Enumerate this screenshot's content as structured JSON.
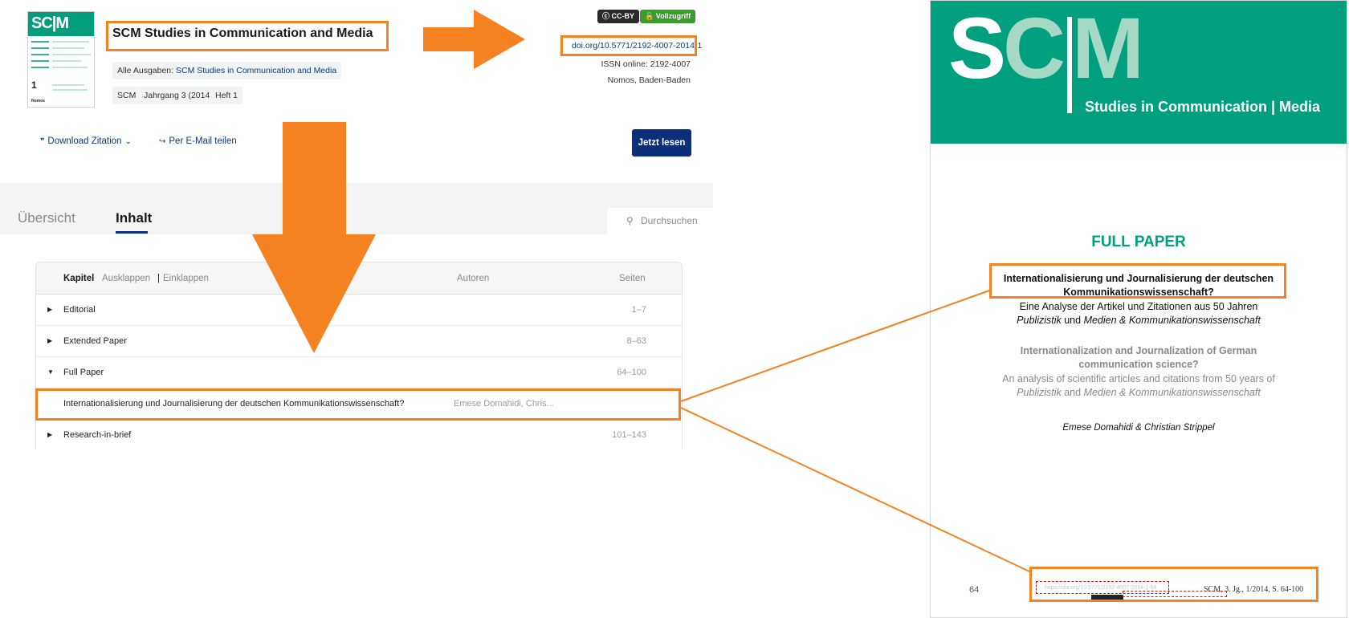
{
  "header": {
    "cover": {
      "logo_text": "SC|M",
      "subtitle": "Studies in Communication | Media",
      "issue_number": "1",
      "issue_year": "2014",
      "publisher": "Nomos"
    },
    "journal_title": "SCM Studies in Communication and Media",
    "all_issues_prefix": "Alle Ausgaben:",
    "all_issues_link": "SCM Studies in Communication and Media",
    "chips": [
      "SCM",
      "Jahrgang 3 (2014)",
      "Heft 1"
    ],
    "badges": {
      "license": "CC-BY",
      "access": "Vollzugriff"
    },
    "doi": "doi.org/10.5771/2192-4007-2014-1",
    "issn": "ISSN online: 2192-4007",
    "publisher_place": "Nomos, Baden-Baden"
  },
  "actions": {
    "download_citation": "Download Zitation",
    "share_email": "Per E-Mail teilen",
    "read_now": "Jetzt lesen"
  },
  "tabs": [
    {
      "label": "Übersicht",
      "active": false
    },
    {
      "label": "Inhalt",
      "active": true
    }
  ],
  "search": {
    "placeholder": "Durchsuchen"
  },
  "toc": {
    "headers": {
      "chapter": "Kapitel",
      "expand": "Ausklappen",
      "separator": "|",
      "collapse": "Einklappen",
      "authors": "Autoren",
      "pages": "Seiten"
    },
    "rows": [
      {
        "title": "Editorial",
        "authors": "",
        "pages": "1–7",
        "expanded": false,
        "child": false
      },
      {
        "title": "Extended Paper",
        "authors": "",
        "pages": "8–63",
        "expanded": false,
        "child": false
      },
      {
        "title": "Full Paper",
        "authors": "",
        "pages": "64–100",
        "expanded": true,
        "child": false
      },
      {
        "title": "Internationalisierung und Journalisierung der deutschen Kommunikationswissenschaft?",
        "authors": "Emese Domahidi, Chris...",
        "pages": "",
        "expanded": false,
        "child": true
      },
      {
        "title": "Research-in-brief",
        "authors": "",
        "pages": "101–143",
        "expanded": false,
        "child": false
      }
    ]
  },
  "pdf": {
    "logo": {
      "s": "S",
      "c": "C",
      "m": "M"
    },
    "journal_subtitle": "Studies in Communication | Media",
    "kicker": "FULL PAPER",
    "title_de_line1": "Internationalisierung und Journalisierung der deutschen",
    "title_de_line2": "Kommunikationswissenschaft?",
    "subtitle_de_line1": "Eine Analyse der Artikel und Zitationen aus 50 Jahren",
    "subtitle_de_line2_it1": "Publizistik",
    "subtitle_de_line2_mid": " und ",
    "subtitle_de_line2_it2": "Medien & Kommunikationswissenschaft",
    "title_en_line1": "Internationalization and Journalization of German",
    "title_en_line2": "communication science?",
    "subtitle_en_line1": "An analysis of scientific articles and citations from 50 years of",
    "subtitle_en_line2_it1": "Publizistik",
    "subtitle_en_line2_mid": " and ",
    "subtitle_en_line2_it2": "Medien & Kommunikationswissenschaft",
    "authors": "Emese Domahidi & Christian Strippel",
    "page_number": "64",
    "citation": "SCM, 3. Jg., 1/2014, S. 64-100"
  },
  "colors": {
    "highlight": "#f58220",
    "brand_green": "#00a07e",
    "primary_blue": "#0b2f7a",
    "open_access_green": "#3d9a2f"
  }
}
